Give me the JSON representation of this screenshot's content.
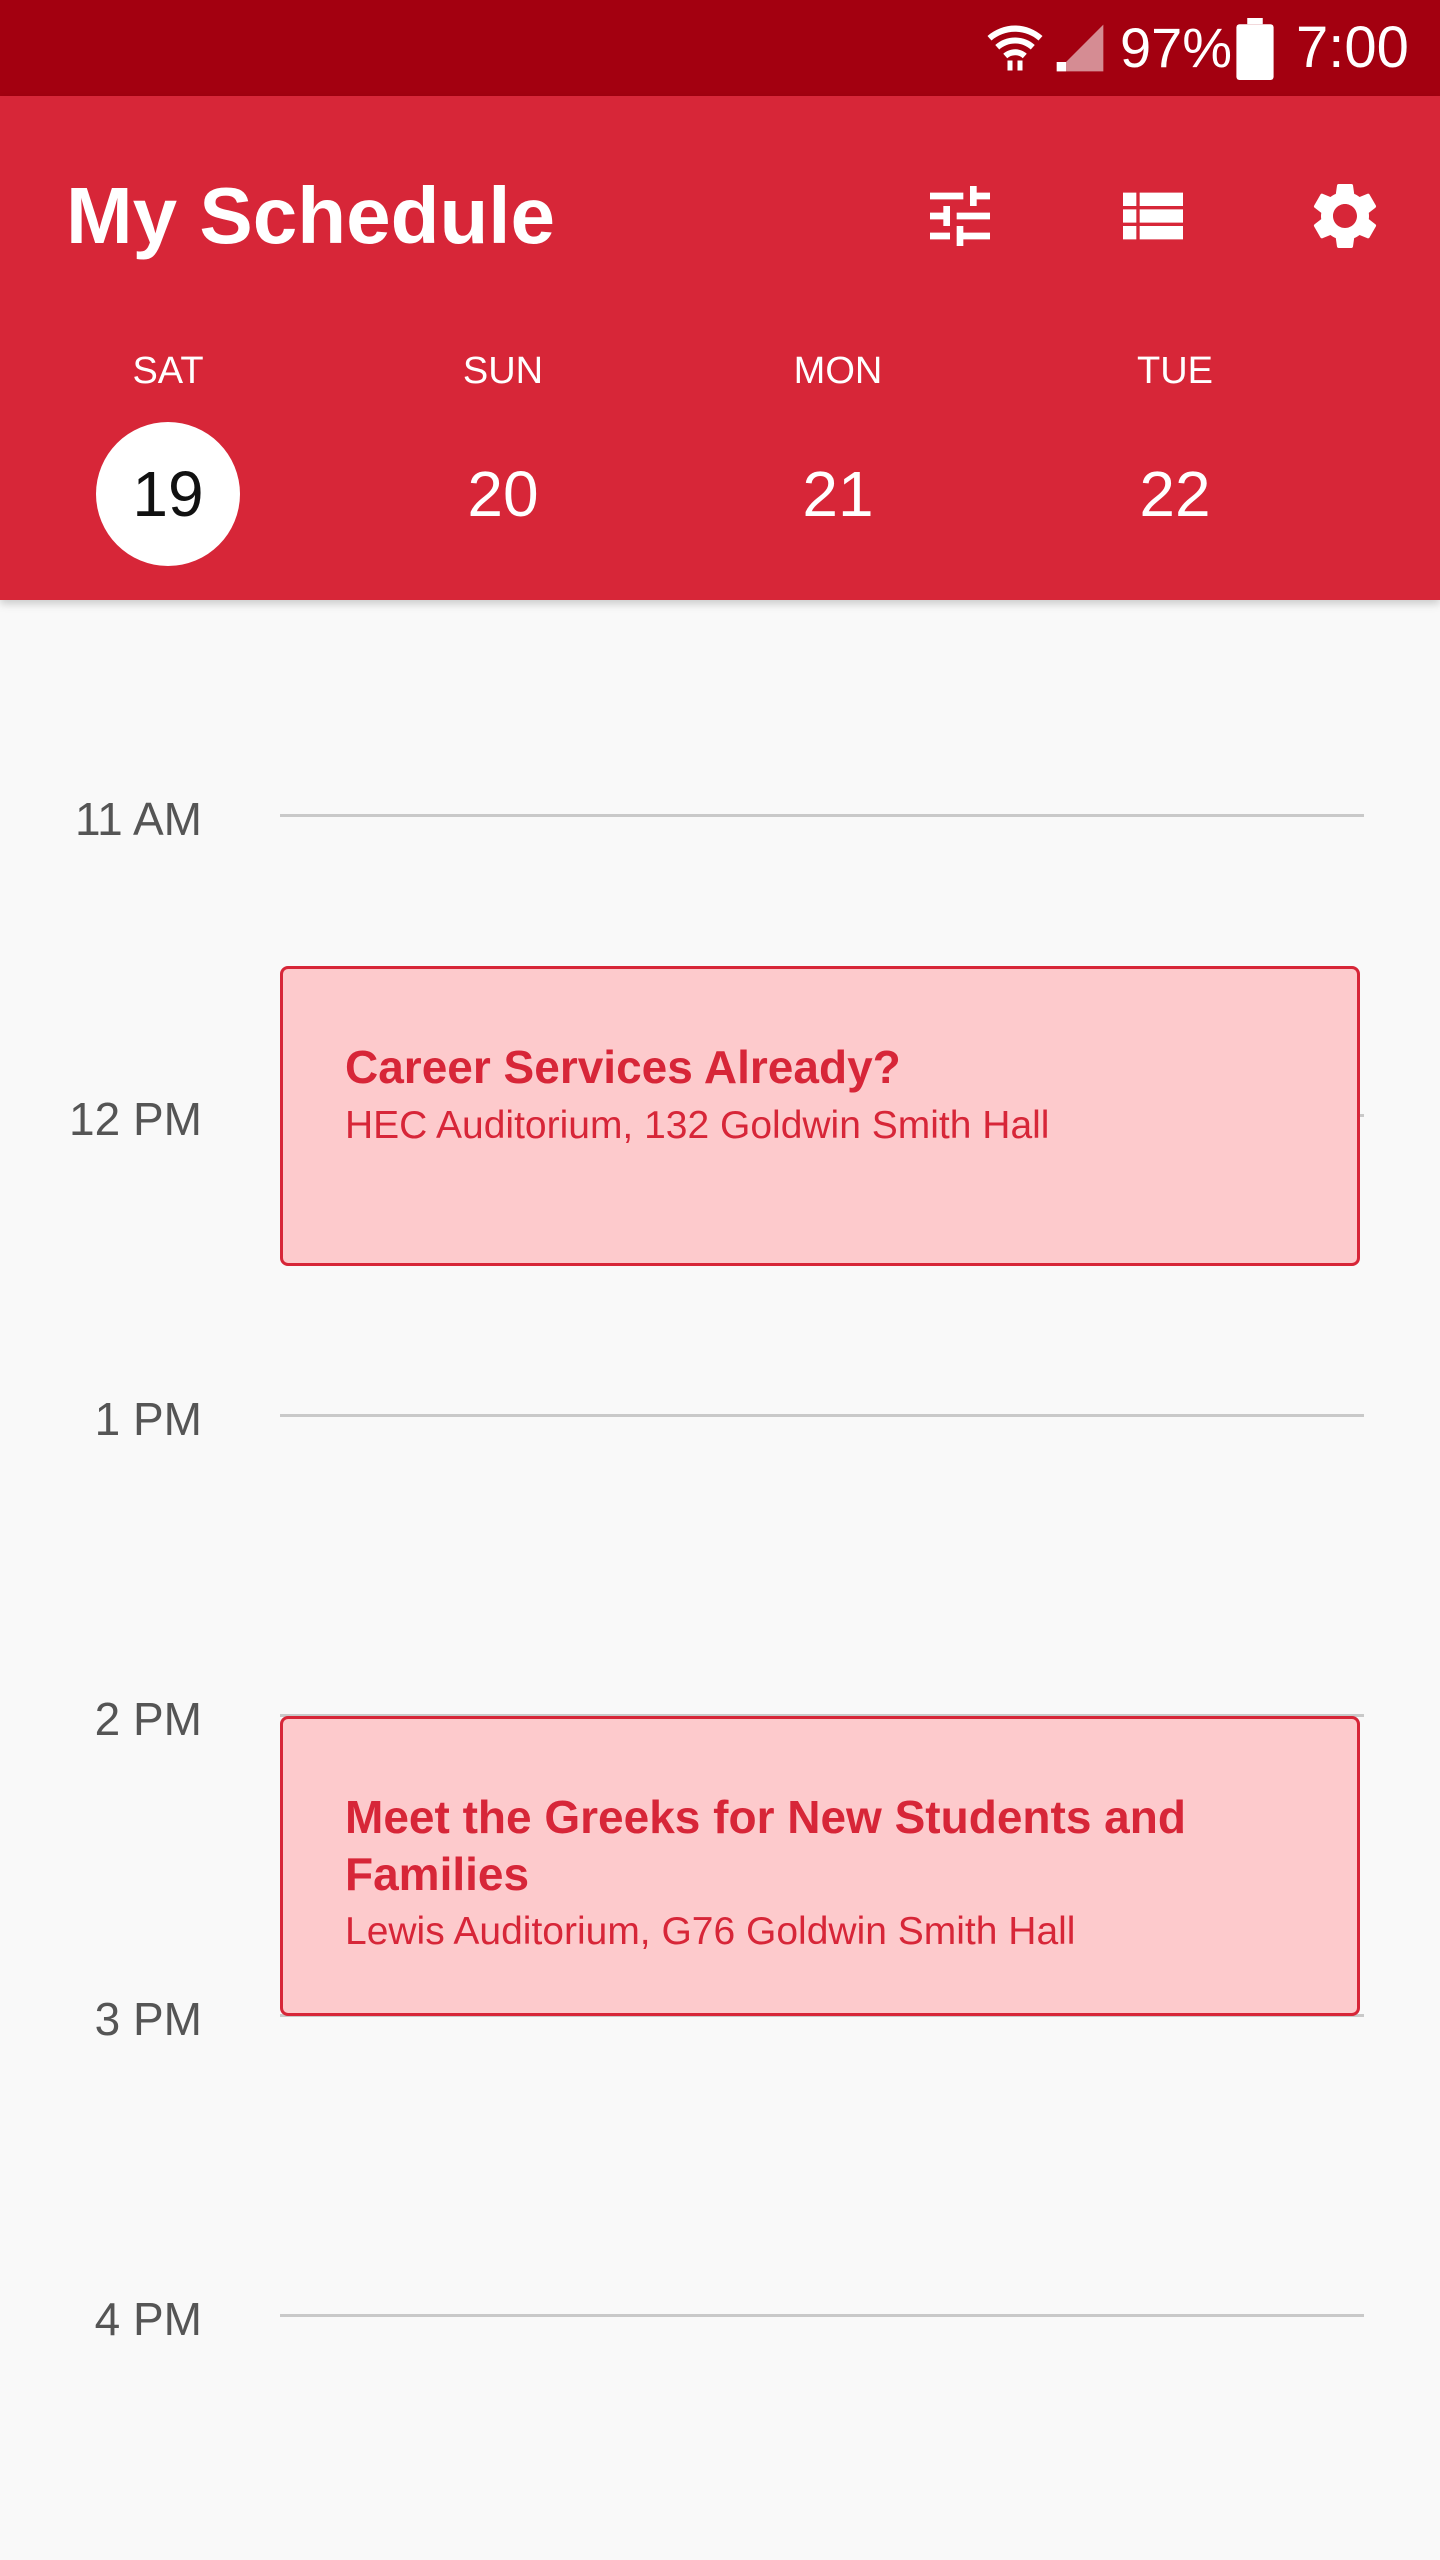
{
  "status_bar": {
    "battery_percent": "97%",
    "time": "7:00",
    "icons": [
      "wifi-icon",
      "signal-icon",
      "battery-icon"
    ]
  },
  "app_bar": {
    "title": "My Schedule",
    "actions": [
      {
        "icon": "filter-icon",
        "label": "Filter"
      },
      {
        "icon": "list-view-icon",
        "label": "List view"
      },
      {
        "icon": "settings-icon",
        "label": "Settings"
      }
    ],
    "accent_color": "#d72638",
    "status_color": "#a30010"
  },
  "days": [
    {
      "weekday": "SAT",
      "date": "19",
      "selected": true
    },
    {
      "weekday": "SUN",
      "date": "20",
      "selected": false
    },
    {
      "weekday": "MON",
      "date": "21",
      "selected": false
    },
    {
      "weekday": "TUE",
      "date": "22",
      "selected": false
    }
  ],
  "timeline": {
    "hours": [
      "11 AM",
      "12 PM",
      "1 PM",
      "2 PM",
      "3 PM",
      "4 PM"
    ]
  },
  "events": [
    {
      "title": "Career Services Already?",
      "location": "HEC Auditorium, 132 Goldwin Smith Hall"
    },
    {
      "title": "Meet the Greeks for New Students and Families",
      "location": "Lewis Auditorium, G76 Goldwin Smith Hall"
    }
  ],
  "colors": {
    "event_fill": "#fdcacc",
    "event_text": "#d72638",
    "background": "#f9f9f9"
  }
}
